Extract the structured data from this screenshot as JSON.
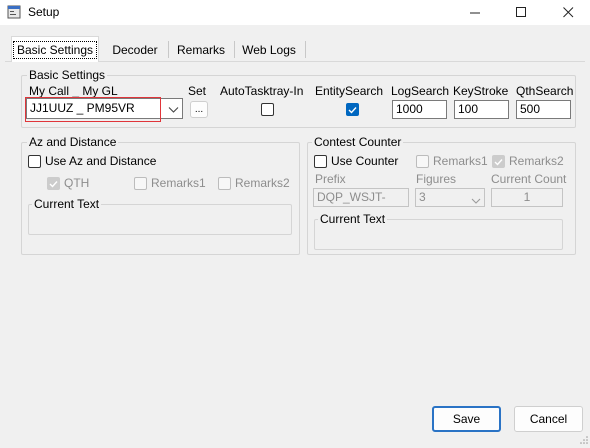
{
  "window": {
    "title": "Setup"
  },
  "tabs": [
    {
      "label": "Basic Settings"
    },
    {
      "label": "Decoder"
    },
    {
      "label": "Remarks"
    },
    {
      "label": "Web Logs"
    }
  ],
  "basic_settings": {
    "legend": "Basic Settings",
    "mycall_label": "My Call _ My GL",
    "mycall_value": "JJ1UUZ _ PM95VR",
    "set_label": "Set",
    "set_button": "...",
    "autotasktray_label": "AutoTasktray-In",
    "autotasktray_checked": false,
    "entitysearch_label": "EntitySearch",
    "entitysearch_checked": true,
    "logsearch_label": "LogSearch",
    "logsearch_value": "1000",
    "keystroke_label": "KeyStroke",
    "keystroke_value": "100",
    "qthsearch_label": "QthSearch",
    "qthsearch_value": "500"
  },
  "az_distance": {
    "legend": "Az and Distance",
    "use_label": "Use Az and Distance",
    "use_checked": false,
    "qth_label": "QTH",
    "qth_checked": true,
    "remarks1_label": "Remarks1",
    "remarks2_label": "Remarks2",
    "current_text_legend": "Current Text"
  },
  "contest_counter": {
    "legend": "Contest Counter",
    "use_label": "Use Counter",
    "use_checked": false,
    "remarks1_label": "Remarks1",
    "remarks2_label": "Remarks2",
    "remarks2_checked": true,
    "prefix_label": "Prefix",
    "prefix_value": "DQP_WSJT-",
    "figures_label": "Figures",
    "figures_value": "3",
    "current_count_label": "Current Count",
    "current_count_value": "1",
    "current_text_legend": "Current Text"
  },
  "buttons": {
    "save": "Save",
    "cancel": "Cancel"
  },
  "colors": {
    "accent": "#0067c0",
    "highlight_box": "#e0353a"
  }
}
